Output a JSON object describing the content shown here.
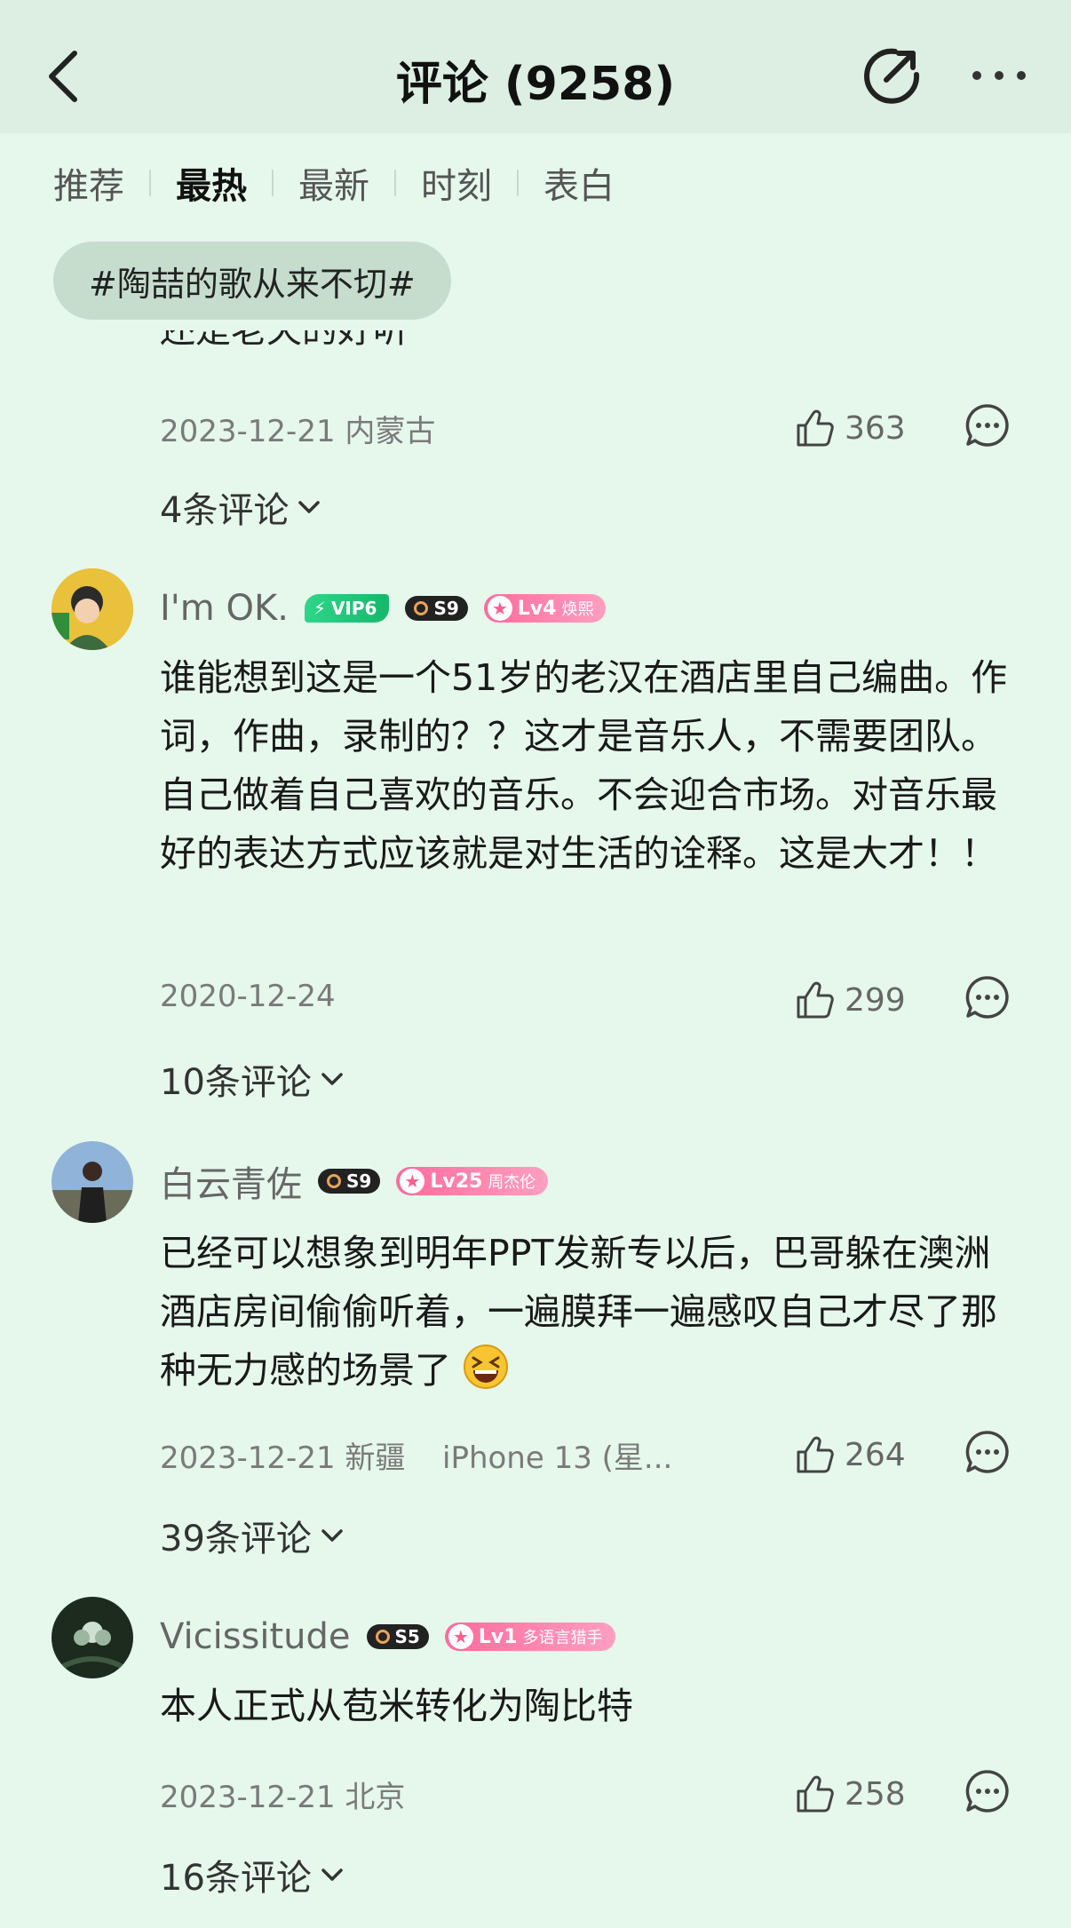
{
  "header": {
    "title": "评论 (9258)"
  },
  "tabs": [
    {
      "label": "推荐"
    },
    {
      "label": "最热"
    },
    {
      "label": "最新"
    },
    {
      "label": "时刻"
    },
    {
      "label": "表白"
    }
  ],
  "topic_chip": "#陶喆的歌从来不切#",
  "partial_comment": {
    "text_cut": "还是老天的好听",
    "date": "2023-12-21 内蒙古",
    "likes": "363",
    "replies": "4条评论"
  },
  "comments": [
    {
      "username": "I'm OK.",
      "vip_label": "VIP6",
      "s_label": "S9",
      "lv_label": "Lv4",
      "lv_name": "焕熙",
      "text": "谁能想到这是一个51岁的老汉在酒店里自己编曲。作词，作曲，录制的？？这才是音乐人，不需要团队。自己做着自己喜欢的音乐。不会迎合市场。对音乐最好的表达方式应该就是对生活的诠释。这是大才！！",
      "date": "2020-12-24",
      "likes": "299",
      "replies": "10条评论"
    },
    {
      "username": "白云青佐",
      "s_label": "S9",
      "lv_label": "Lv25",
      "lv_name": "周杰伦",
      "text": "已经可以想象到明年PPT发新专以后，巴哥躲在澳洲酒店房间偷偷听着，一遍膜拜一遍感叹自己才尽了那种无力感的场景了",
      "date": "2023-12-21 新疆",
      "device": "iPhone 13 (星...",
      "likes": "264",
      "replies": "39条评论"
    },
    {
      "username": "Vicissitude",
      "s_label": "S5",
      "lv_label": "Lv1",
      "lv_name": "多语言猎手",
      "text": "本人正式从苞米转化为陶比特",
      "date": "2023-12-21 北京",
      "likes": "258",
      "replies": "16条评论"
    }
  ],
  "icons": {
    "back": "chevron-left-icon",
    "share": "share-icon",
    "more": "more-dots-icon",
    "like": "thumb-up-icon",
    "reply": "comment-bubble-icon",
    "expand": "chevron-down-icon"
  },
  "colors": {
    "background": "#e6f7ec",
    "header": "#dcefe2",
    "vip": "#15b86b",
    "level": "#ff6a9c"
  }
}
